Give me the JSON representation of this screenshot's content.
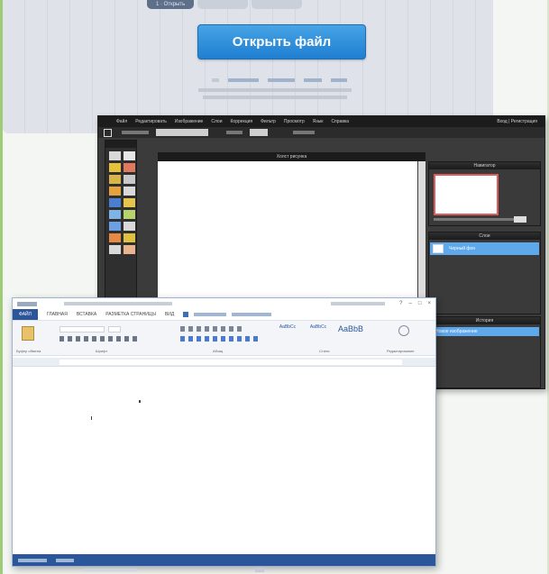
{
  "colors": {
    "open_button": "#1f7fd1",
    "word_blue": "#2b579a",
    "editor_dark": "#3b3b3b",
    "layer_highlight": "#5ea8ec",
    "page_green_border": "#9ecb76"
  },
  "web": {
    "tabs": [
      "1 · Открыть",
      "",
      ""
    ],
    "open_button_label": "Открыть файл",
    "sources": [
      "",
      "",
      "",
      ""
    ],
    "hint_1": "",
    "hint_2": ""
  },
  "editor": {
    "menu_items": [
      "Файл",
      "Редактировать",
      "Изображение",
      "Слои",
      "Коррекция",
      "Фильтр",
      "Просмотр",
      "Язык",
      "Справка"
    ],
    "menu_right": "Вход | Регистрация",
    "options": [
      "",
      "",
      "",
      ""
    ],
    "toolbox_title": "",
    "canvas_title": "Холст рисунка",
    "panel_navigator": "Навигатор",
    "panel_layers": "Слои",
    "layer_name": "Черный фон",
    "panel_history": "История",
    "history_item": "Новое изображение"
  },
  "word": {
    "title": "",
    "user": "",
    "tabs": [
      "ФАЙЛ",
      "ГЛАВНАЯ",
      "ВСТАВКА",
      "РАЗМЕТКА СТРАНИЦЫ",
      "ВИД"
    ],
    "tellme": "",
    "styles": [
      "AaBbCc",
      "AaBbCc",
      "AaBbB"
    ],
    "groups": [
      "Буфер обмена",
      "Шрифт",
      "Абзац",
      "Стили",
      "Редактирование"
    ],
    "statusbar": ""
  }
}
